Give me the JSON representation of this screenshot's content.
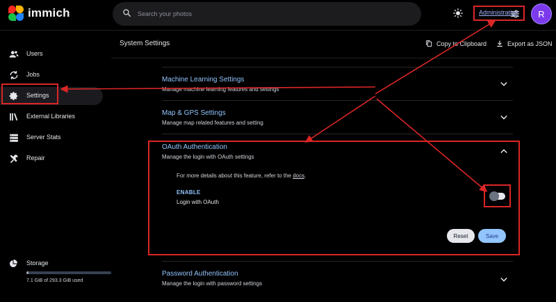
{
  "app": {
    "name": "immich"
  },
  "search": {
    "placeholder": "Search your photos"
  },
  "header": {
    "admin_label": "Administration",
    "avatar_initial": "R"
  },
  "sidebar": {
    "items": [
      {
        "label": "Users",
        "icon": "users-icon"
      },
      {
        "label": "Jobs",
        "icon": "sync-icon"
      },
      {
        "label": "Settings",
        "icon": "gear-icon",
        "active": true
      },
      {
        "label": "External Libraries",
        "icon": "library-icon"
      },
      {
        "label": "Server Stats",
        "icon": "server-icon"
      },
      {
        "label": "Repair",
        "icon": "tools-icon"
      }
    ],
    "storage": {
      "label": "Storage",
      "usage_text": "7.1 GiB of 293.3 GiB used",
      "used_fraction": 0.024
    }
  },
  "page": {
    "title": "System Settings",
    "copy_label": "Copy to Clipboard",
    "export_label": "Export as JSON"
  },
  "panels": {
    "ml": {
      "title": "Machine Learning Settings",
      "subtitle": "Manage machine learning features and settings"
    },
    "map": {
      "title": "Map & GPS Settings",
      "subtitle": "Manage map related features and setting"
    },
    "oauth": {
      "title": "OAuth Authentication",
      "subtitle": "Manage the login with OAuth settings",
      "details_prefix": "For more details about this feature, refer to the ",
      "details_link": "docs",
      "details_suffix": ".",
      "enable_label": "ENABLE",
      "enable_sub": "Login with OAuth",
      "enabled": false,
      "reset_label": "Reset",
      "save_label": "Save"
    },
    "password": {
      "title": "Password Authentication",
      "subtitle": "Manage the login with password settings"
    }
  },
  "colors": {
    "accent": "#93c5fd",
    "highlight": "#dc2626",
    "avatar": "#7c3aed"
  }
}
